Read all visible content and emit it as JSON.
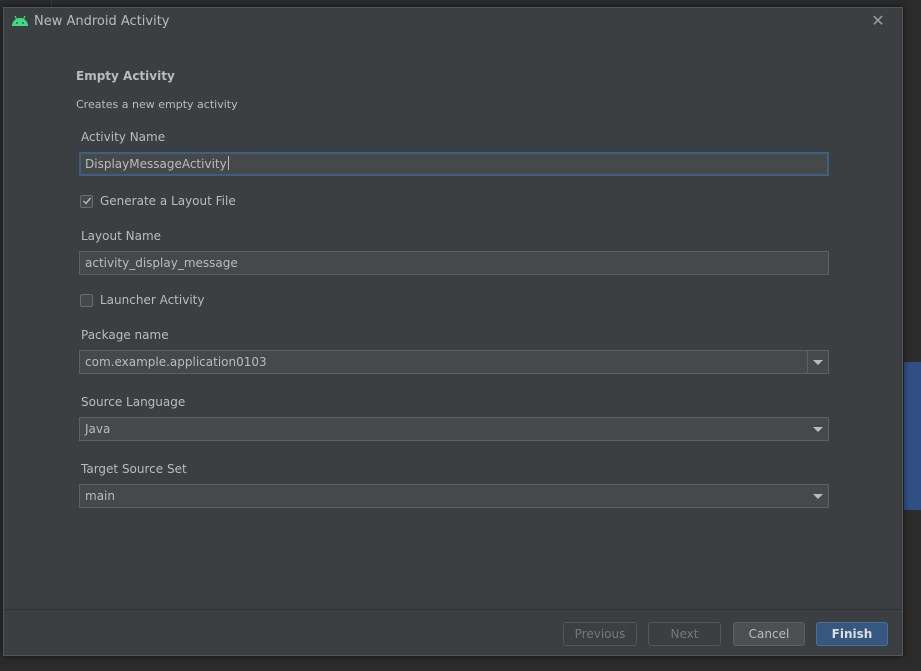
{
  "window": {
    "title": "New Android Activity",
    "icon": "android-icon",
    "close_icon": "close-icon"
  },
  "form": {
    "heading": "Empty Activity",
    "subheading": "Creates a new empty activity",
    "activity_name": {
      "label": "Activity Name",
      "value": "DisplayMessageActivity"
    },
    "generate_layout": {
      "label": "Generate a Layout File",
      "checked": true
    },
    "layout_name": {
      "label": "Layout Name",
      "value": "activity_display_message"
    },
    "launcher_activity": {
      "label": "Launcher Activity",
      "checked": false
    },
    "package_name": {
      "label": "Package name",
      "value": "com.example.application0103"
    },
    "source_language": {
      "label": "Source Language",
      "value": "Java"
    },
    "target_source_set": {
      "label": "Target Source Set",
      "value": "main"
    }
  },
  "buttons": {
    "previous": "Previous",
    "next": "Next",
    "cancel": "Cancel",
    "finish": "Finish"
  },
  "colors": {
    "android_green": "#3ddc84",
    "primary_button": "#365880",
    "focus_border": "#3d6185"
  }
}
